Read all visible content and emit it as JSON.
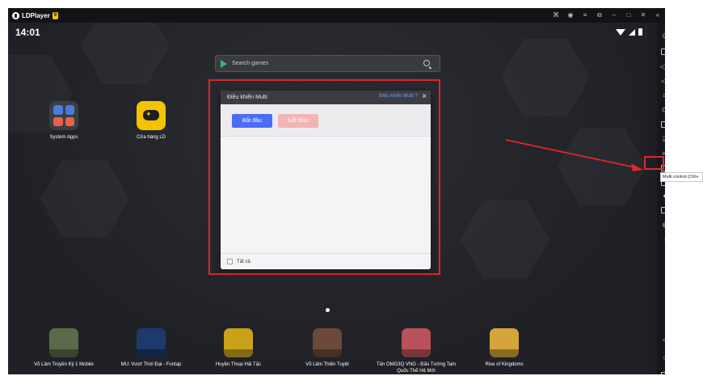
{
  "window": {
    "title": "LDPlayer",
    "version_badge": "9"
  },
  "titlebar_icons": [
    "gamepad-icon",
    "account-icon",
    "menu-icon",
    "restore-icon",
    "minimize-icon",
    "maximize-icon",
    "close-icon",
    "collapse-icon"
  ],
  "status_bar": {
    "time": "14:01"
  },
  "search": {
    "placeholder": "Search games"
  },
  "home_apps": [
    {
      "label": "System Apps"
    },
    {
      "label": "Cửa hàng LD"
    }
  ],
  "dialog": {
    "title": "Điều khiển Multi",
    "help_link": "Điều khiển Multi ?",
    "start_button": "Bắt đầu",
    "end_button": "Kết thúc",
    "select_all_label": "Tất cả"
  },
  "games": [
    {
      "label": "Võ Lâm Truyền Kỳ 1 Mobile",
      "color": "#5a6b4a"
    },
    {
      "label": "MU: Vượt Thời Đại - Funtap",
      "color": "#1d3a6e"
    },
    {
      "label": "Huyền Thoại Hải Tặc",
      "color": "#c9a21c"
    },
    {
      "label": "Võ Lâm Thiên Tuyệt",
      "color": "#6b4a3a"
    },
    {
      "label": "Tân OMG3Q VNG - Đấu Tướng Tam Quốc Thế Hệ Mới",
      "color": "#b8525a"
    },
    {
      "label": "Rise of Kingdoms",
      "color": "#d4a53a"
    }
  ],
  "sidebar": {
    "items": [
      "settings-icon",
      "keyboard-icon",
      "volume-up-icon",
      "volume-down-icon",
      "fullscreen-icon",
      "sync-icon",
      "screenshot-icon",
      "apk-icon",
      "cut-icon",
      "record-icon",
      "multi-control-icon",
      "operations-icon",
      "folder-icon",
      "location-icon",
      "shake-icon",
      "back-icon",
      "home-icon",
      "recent-apps-icon"
    ],
    "tooltip": "Multi control (Ctrl+"
  },
  "colors": {
    "accent_red": "#e0262b",
    "primary_blue": "#4a6cf7",
    "brand_yellow": "#f5c400"
  }
}
